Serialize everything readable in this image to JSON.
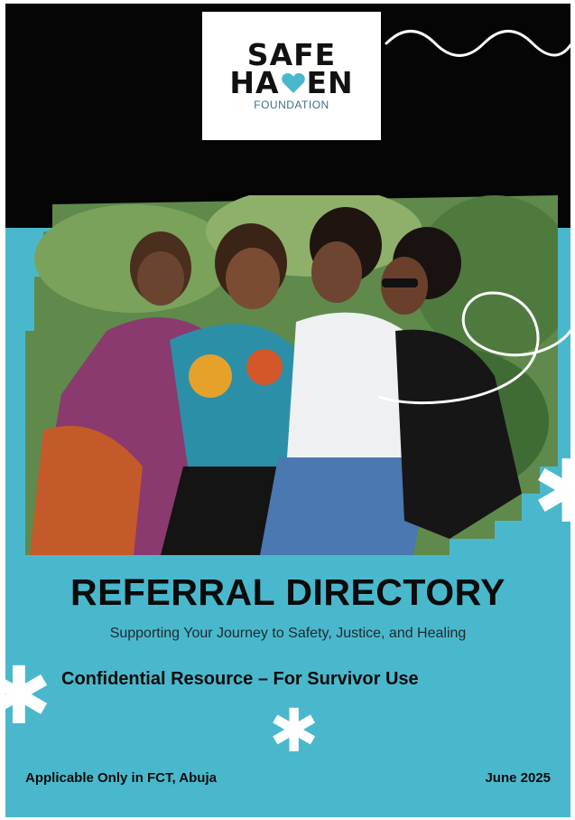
{
  "logo": {
    "line1": "SAFE",
    "line2_start": "HA",
    "line2_end": "EN",
    "line3": "FOUNDATION",
    "icon": "heart-icon"
  },
  "title": "REFERRAL DIRECTORY",
  "subtitle": "Supporting Your Journey to Safety, Justice, and Healing",
  "tagline": "Confidential Resource – For Survivor Use",
  "footer": {
    "location": "Applicable Only in FCT, Abuja",
    "date": "June 2025"
  },
  "colors": {
    "background": "#4ab8cc",
    "band": "#050505",
    "heart": "#4ab8cc",
    "text": "#0b0b0b"
  }
}
